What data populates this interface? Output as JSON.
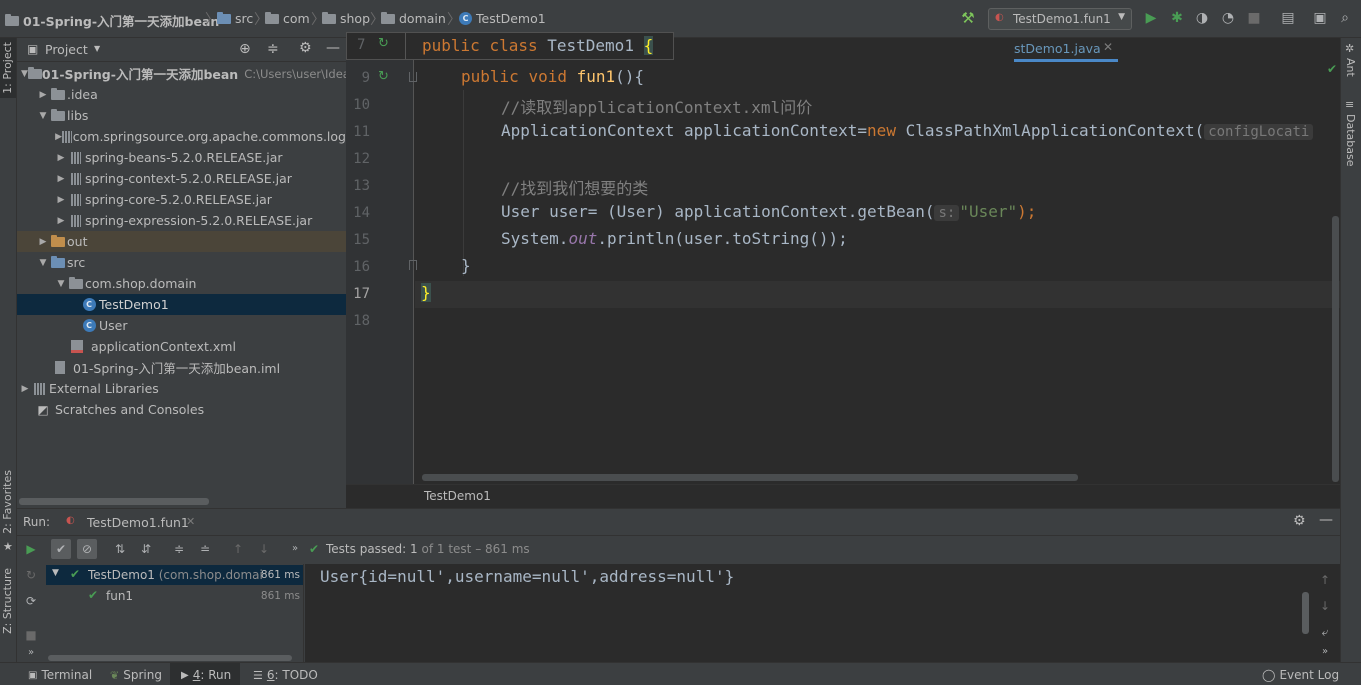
{
  "breadcrumb": {
    "project": "01-Spring-入门第一天添加bean",
    "src": "src",
    "com": "com",
    "shop": "shop",
    "domain": "domain",
    "file": "TestDemo1"
  },
  "toolbar": {
    "run_config": "TestDemo1.fun1"
  },
  "left_strip": {
    "project_tab": "1: Project",
    "favorites_tab": "2: Favorites",
    "structure_tab": "Z: Structure"
  },
  "right_strip": {
    "ant_tab": "Ant",
    "database_tab": "Database"
  },
  "project_panel": {
    "title": "Project",
    "tree": [
      {
        "label": "01-Spring-入门第一天添加bean",
        "hint": "C:\\Users\\user\\Idea"
      },
      {
        "label": ".idea"
      },
      {
        "label": "libs"
      },
      {
        "label": "com.springsource.org.apache.commons.log"
      },
      {
        "label": "spring-beans-5.2.0.RELEASE.jar"
      },
      {
        "label": "spring-context-5.2.0.RELEASE.jar"
      },
      {
        "label": "spring-core-5.2.0.RELEASE.jar"
      },
      {
        "label": "spring-expression-5.2.0.RELEASE.jar"
      },
      {
        "label": "out"
      },
      {
        "label": "src"
      },
      {
        "label": "com.shop.domain"
      },
      {
        "label": "TestDemo1"
      },
      {
        "label": "User"
      },
      {
        "label": "applicationContext.xml"
      },
      {
        "label": "01-Spring-入门第一天添加bean.iml"
      },
      {
        "label": "External Libraries"
      },
      {
        "label": "Scratches and Consoles"
      }
    ]
  },
  "editor": {
    "tab_label": "stDemo1.java",
    "sticky_line_number": "7",
    "sticky": {
      "kw1": "public",
      "kw2": "class",
      "name": "TestDemo1",
      "brace": "{"
    },
    "line_numbers": [
      "9",
      "10",
      "11",
      "12",
      "13",
      "14",
      "15",
      "16",
      "17",
      "18"
    ],
    "lines": {
      "l9": {
        "kw1": "public",
        "kw2": "void",
        "fn": "fun1",
        "rest": "(){"
      },
      "l10": "//读取到applicationContext.xml问价",
      "l11": {
        "a": "ApplicationContext applicationContext=",
        "kw": "new",
        "b": " ClassPathXmlApplicationContext(",
        "hint": "configLocati"
      },
      "l13": "//找到我们想要的类",
      "l14": {
        "a": "User user= (User) applicationContext.getBean(",
        "hint": "s:",
        "str": "\"User\"",
        "b": ");"
      },
      "l15": {
        "a": "System.",
        "it": "out",
        "b": ".println(user.toString());"
      },
      "l16": "}",
      "l17": "}"
    },
    "breadcrumb": "TestDemo1"
  },
  "run_panel": {
    "label": "Run:",
    "config_tab": "TestDemo1.fun1",
    "status_passed": "Tests passed: 1",
    "status_detail": "of 1 test – 861 ms",
    "tree": [
      {
        "name": "TestDemo1",
        "detail": "(com.shop.domai",
        "time": "861 ms"
      },
      {
        "name": "fun1",
        "detail": "",
        "time": "861 ms"
      }
    ],
    "console_output": "User{id=null',username=null',address=null'}"
  },
  "bottom_tabs": {
    "terminal": "Terminal",
    "spring": "Spring",
    "run_num": "4",
    "run": ": Run",
    "todo_num": "6",
    "todo": ": TODO",
    "event_log": "Event Log"
  },
  "colors": {
    "background": "#2b2b2b",
    "panel": "#3c3f41",
    "keyword": "#cc7832",
    "function": "#ffc66d",
    "string": "#6a8759",
    "comment": "#808080",
    "selection": "#0d293e",
    "success": "#499c54"
  }
}
